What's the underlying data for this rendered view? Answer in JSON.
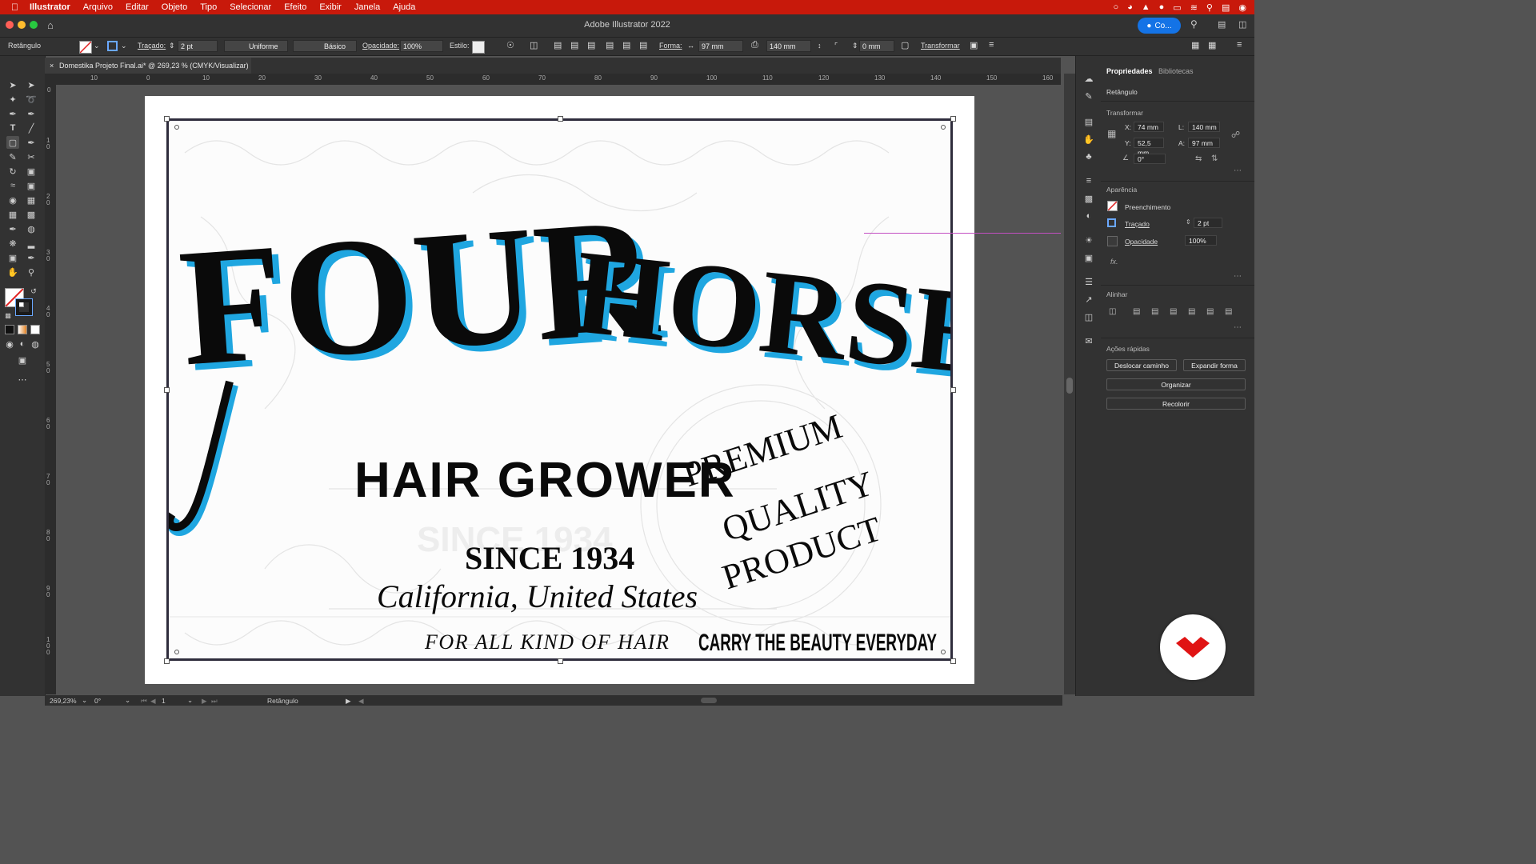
{
  "menubar": {
    "app": "Illustrator",
    "items": [
      "Arquivo",
      "Editar",
      "Objeto",
      "Tipo",
      "Selecionar",
      "Efeito",
      "Exibir",
      "Janela",
      "Ajuda"
    ]
  },
  "titlebar": {
    "title": "Adobe Illustrator 2022",
    "share_label": "Co..."
  },
  "controlbar": {
    "selection": "Retângulo",
    "stroke_label": "Traçado:",
    "stroke_value": "2 pt",
    "stroke_profile": "Uniforme",
    "brush": "Básico",
    "opacity_label": "Opacidade:",
    "opacity_value": "100%",
    "style_label": "Estilo:",
    "shape_label": "Forma:",
    "width": "97 mm",
    "height": "140 mm",
    "radius": "0 mm",
    "transform_label": "Transformar"
  },
  "document_tab": {
    "title": "Domestika Projeto Final.ai* @ 269,23 % (CMYK/Visualizar)"
  },
  "ruler": {
    "h_labels": [
      "10",
      "0",
      "10",
      "20",
      "30",
      "40",
      "50",
      "60",
      "70",
      "80",
      "90",
      "100",
      "110",
      "120",
      "130",
      "140",
      "150",
      "160"
    ],
    "v_labels": [
      "0",
      "10",
      "20",
      "30",
      "40",
      "50",
      "60",
      "70",
      "80",
      "90",
      "100"
    ]
  },
  "artwork": {
    "word1": "FOUR",
    "word2": "HORSES",
    "product": "HAIR GROWER",
    "since": "SINCE 1934",
    "location": "California, United States",
    "premium": [
      "PREMIUM",
      "QUALITY",
      "PRODUCT"
    ],
    "tagline_left": "FOR ALL KIND OF HAIR",
    "tagline_right": "CARRY THE BEAUTY EVERYDAY",
    "colors": {
      "black": "#0a0a0a",
      "blue": "#1fa6e0",
      "border": "#2e2c3c"
    }
  },
  "properties": {
    "tabs": [
      "Propriedades",
      "Bibliotecas"
    ],
    "object_type": "Retângulo",
    "transform": {
      "title": "Transformar",
      "x_label": "X:",
      "x": "74 mm",
      "y_label": "Y:",
      "y": "52,5 mm",
      "w_label": "L:",
      "w": "140 mm",
      "h_label": "A:",
      "h": "97 mm",
      "angle": "0°"
    },
    "appearance": {
      "title": "Aparência",
      "fill": "Preenchimento",
      "stroke": "Traçado",
      "stroke_value": "2 pt",
      "opacity": "Opacidade",
      "opacity_value": "100%",
      "fx": "fx."
    },
    "align": {
      "title": "Alinhar"
    },
    "quick_actions": {
      "title": "Ações rápidas",
      "offset_path": "Deslocar caminho",
      "expand_shape": "Expandir forma",
      "arrange": "Organizar",
      "recolor": "Recolorir"
    }
  },
  "statusbar": {
    "zoom": "269,23%",
    "rotation": "0°",
    "artboard": "1",
    "tool": "Retângulo"
  }
}
